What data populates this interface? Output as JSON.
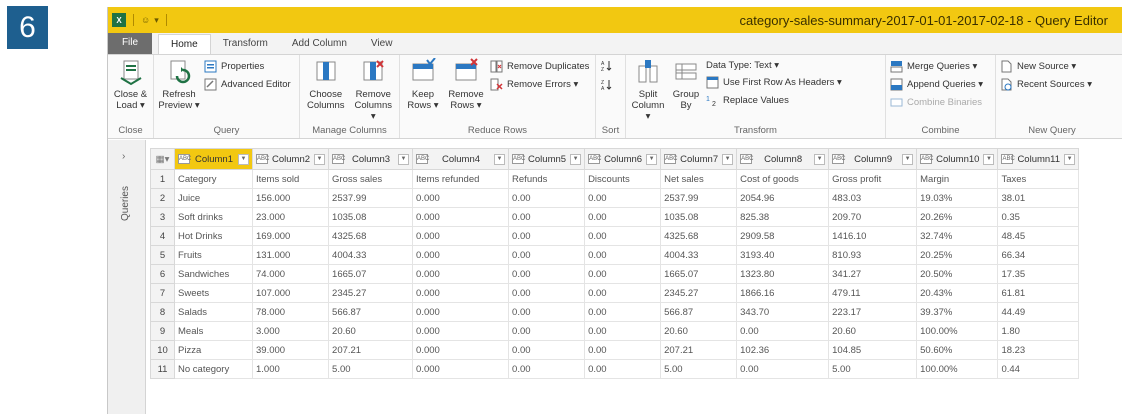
{
  "step_number": "6",
  "window": {
    "title": "category-sales-summary-2017-01-01-2017-02-18 - Query Editor",
    "app_icon": "X│"
  },
  "quick_access": {
    "smiley": "☺",
    "dropdown": "▾",
    "sep": "│"
  },
  "tabs": [
    {
      "label": "File"
    },
    {
      "label": "Home"
    },
    {
      "label": "Transform"
    },
    {
      "label": "Add Column"
    },
    {
      "label": "View"
    }
  ],
  "ribbon": {
    "close_load": "Close & Load ▾",
    "close_group": "Close",
    "refresh_preview": "Refresh Preview ▾",
    "properties": "Properties",
    "advanced_editor": "Advanced Editor",
    "query_group": "Query",
    "choose_columns": "Choose Columns",
    "remove_columns": "Remove Columns ▾",
    "manage_columns_group": "Manage Columns",
    "keep_rows": "Keep Rows ▾",
    "remove_rows": "Remove Rows ▾",
    "remove_duplicates": "Remove Duplicates",
    "remove_errors": "Remove Errors ▾",
    "reduce_rows_group": "Reduce Rows",
    "sort_group": "Sort",
    "split_column": "Split Column ▾",
    "group_by": "Group By",
    "data_type": "Data Type: Text ▾",
    "use_first_row": "Use First Row As Headers ▾",
    "replace_values": "Replace Values",
    "transform_group": "Transform",
    "merge_queries": "Merge Queries ▾",
    "append_queries": "Append Queries ▾",
    "combine_binaries": "Combine Binaries",
    "combine_group": "Combine",
    "new_source": "New Source ▾",
    "recent_sources": "Recent Sources ▾",
    "new_query_group": "New Query"
  },
  "queries_pane": {
    "label": "Queries",
    "chevron": "›"
  },
  "grid": {
    "columns": [
      "Column1",
      "Column2",
      "Column3",
      "Column4",
      "Column5",
      "Column6",
      "Column7",
      "Column8",
      "Column9",
      "Column10",
      "Column11"
    ],
    "rows": [
      [
        "1",
        "Category",
        "Items sold",
        "Gross sales",
        "Items refunded",
        "Refunds",
        "Discounts",
        "Net sales",
        "Cost of goods",
        "Gross profit",
        "Margin",
        "Taxes"
      ],
      [
        "2",
        "Juice",
        "156.000",
        "2537.99",
        "0.000",
        "0.00",
        "0.00",
        "2537.99",
        "2054.96",
        "483.03",
        "19.03%",
        "38.01"
      ],
      [
        "3",
        "Soft drinks",
        "23.000",
        "1035.08",
        "0.000",
        "0.00",
        "0.00",
        "1035.08",
        "825.38",
        "209.70",
        "20.26%",
        "0.35"
      ],
      [
        "4",
        "Hot Drinks",
        "169.000",
        "4325.68",
        "0.000",
        "0.00",
        "0.00",
        "4325.68",
        "2909.58",
        "1416.10",
        "32.74%",
        "48.45"
      ],
      [
        "5",
        "Fruits",
        "131.000",
        "4004.33",
        "0.000",
        "0.00",
        "0.00",
        "4004.33",
        "3193.40",
        "810.93",
        "20.25%",
        "66.34"
      ],
      [
        "6",
        "Sandwiches",
        "74.000",
        "1665.07",
        "0.000",
        "0.00",
        "0.00",
        "1665.07",
        "1323.80",
        "341.27",
        "20.50%",
        "17.35"
      ],
      [
        "7",
        "Sweets",
        "107.000",
        "2345.27",
        "0.000",
        "0.00",
        "0.00",
        "2345.27",
        "1866.16",
        "479.11",
        "20.43%",
        "61.81"
      ],
      [
        "8",
        "Salads",
        "78.000",
        "566.87",
        "0.000",
        "0.00",
        "0.00",
        "566.87",
        "343.70",
        "223.17",
        "39.37%",
        "44.49"
      ],
      [
        "9",
        "Meals",
        "3.000",
        "20.60",
        "0.000",
        "0.00",
        "0.00",
        "20.60",
        "0.00",
        "20.60",
        "100.00%",
        "1.80"
      ],
      [
        "10",
        "Pizza",
        "39.000",
        "207.21",
        "0.000",
        "0.00",
        "0.00",
        "207.21",
        "102.36",
        "104.85",
        "50.60%",
        "18.23"
      ],
      [
        "11",
        "No category",
        "1.000",
        "5.00",
        "0.000",
        "0.00",
        "0.00",
        "5.00",
        "0.00",
        "5.00",
        "100.00%",
        "0.44"
      ]
    ]
  },
  "colors": {
    "accent": "#f2c811",
    "badge": "#1e5f8f",
    "excel_green": "#1f7244"
  }
}
